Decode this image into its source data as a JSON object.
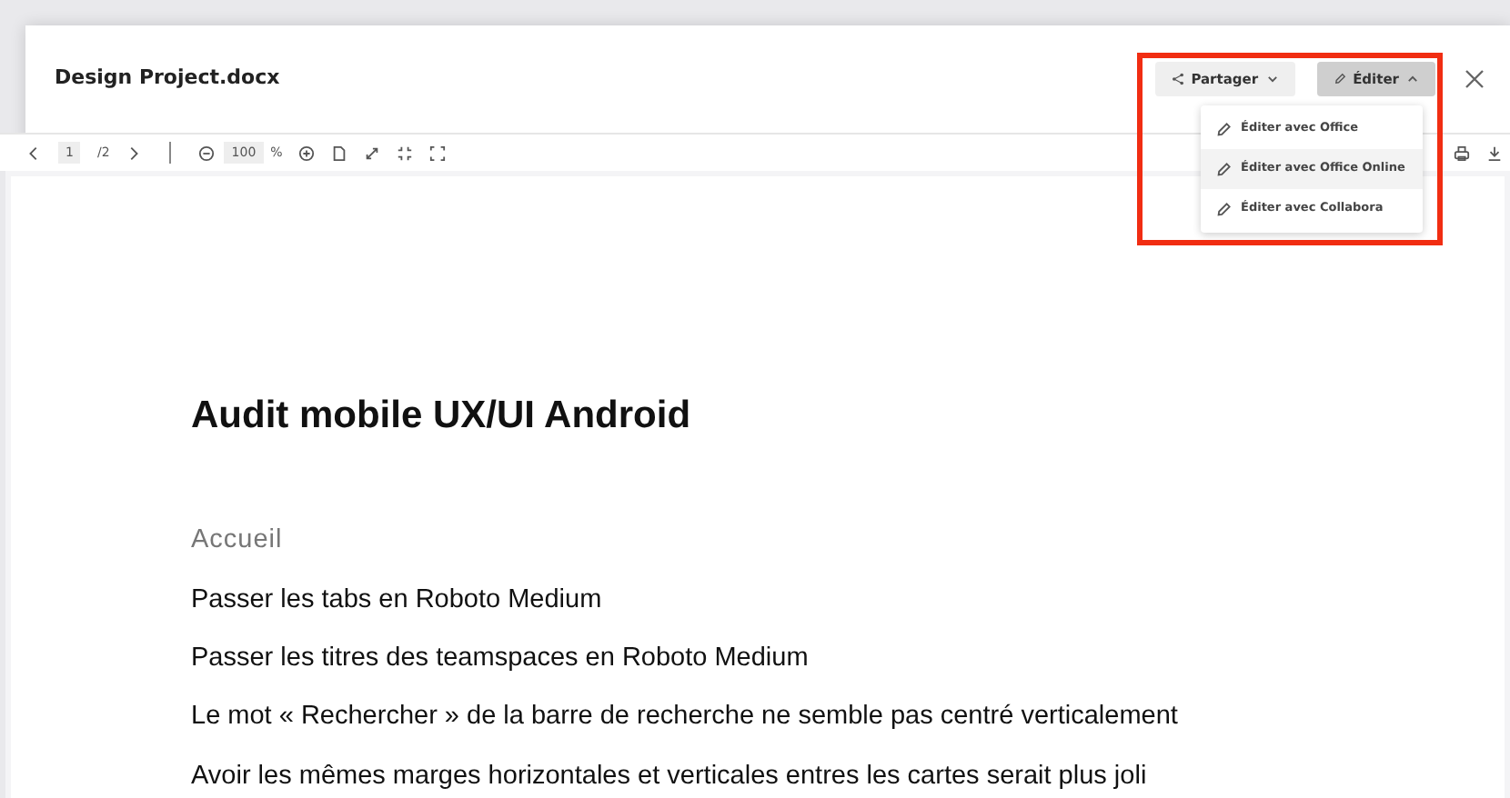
{
  "dialog": {
    "title": "Design Project.docx",
    "share_button": "Partager",
    "edit_button": {
      "label": "Éditer",
      "expanded": true
    },
    "edit_menu": [
      {
        "label": "Éditer avec Office",
        "highlighted": false
      },
      {
        "label": "Éditer avec Office Online",
        "highlighted": true
      },
      {
        "label": "Éditer avec Collabora",
        "highlighted": false
      }
    ]
  },
  "toolbar": {
    "page": "1",
    "page_count": "/2",
    "zoom": "100",
    "zoom_unit": "%"
  },
  "document": {
    "title": "Audit mobile UX/UI Android",
    "section": "Accueil",
    "paragraphs": [
      "Passer les tabs en Roboto Medium",
      "Passer les titres des teamspaces en Roboto Medium",
      "Le mot « Rechercher » de la barre de recherche ne semble pas centré verticalement",
      "Avoir les mêmes marges horizontales et verticales entres les cartes serait plus joli"
    ]
  }
}
